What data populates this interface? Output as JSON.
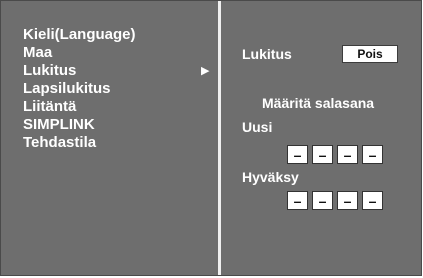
{
  "menu": {
    "items": [
      {
        "label": "Kieli(Language)"
      },
      {
        "label": "Maa"
      },
      {
        "label": "Lukitus",
        "arrow": "▶"
      },
      {
        "label": "Lapsilukitus"
      },
      {
        "label": "Liitäntä"
      },
      {
        "label": "SIMPLINK"
      },
      {
        "label": "Tehdastila"
      }
    ]
  },
  "panel": {
    "lock_label": "Lukitus",
    "lock_value": "Pois",
    "set_password_label": "Määritä salasana",
    "new_label": "Uusi",
    "confirm_label": "Hyväksy",
    "new_pin": [
      "–",
      "–",
      "–",
      "–"
    ],
    "confirm_pin": [
      "–",
      "–",
      "–",
      "–"
    ]
  }
}
